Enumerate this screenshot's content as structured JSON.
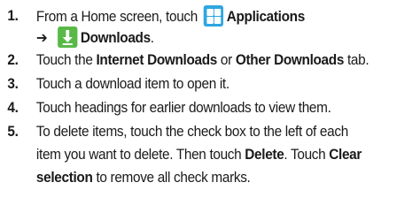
{
  "steps": [
    {
      "number": "1.",
      "line1_pre": "From a Home screen, touch",
      "apps_label": "Applications",
      "arrow": "➔",
      "downloads_label": "Downloads",
      "line2_post": ".",
      "icons": [
        "applications-grid-icon",
        "downloads-icon"
      ]
    },
    {
      "number": "2.",
      "pre": "Touch the ",
      "b1": "Internet Downloads",
      "mid": " or ",
      "b2": "Other Downloads",
      "post": " tab."
    },
    {
      "number": "3.",
      "text": "Touch a download item to open it."
    },
    {
      "number": "4.",
      "text": "Touch headings for earlier downloads to view them."
    },
    {
      "number": "5.",
      "line1": "To delete items, touch the check box to the left of each",
      "line2_pre": "item you want to delete. Then touch ",
      "delete_label": "Delete",
      "line2_mid": ". Touch ",
      "clear_label": "Clear",
      "line3_bold": "selection",
      "line3_post": " to remove all check marks."
    }
  ],
  "colors": {
    "applications_icon": "#2fa6e0",
    "downloads_icon": "#58b947",
    "text": "#1a1a1a"
  }
}
